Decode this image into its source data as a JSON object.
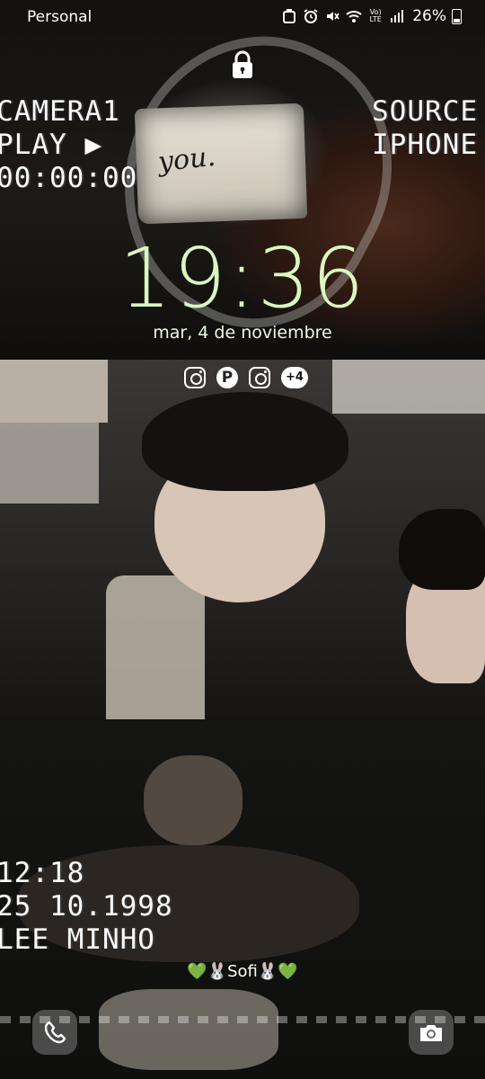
{
  "status_bar": {
    "carrier": "Personal",
    "battery_percent": "26%",
    "icons": [
      "card-icon",
      "alarm-icon",
      "mute-icon",
      "wifi-icon",
      "volte-icon",
      "signal-icon",
      "battery-icon"
    ],
    "volte_label": "Vo)\nLTE"
  },
  "lock": {
    "icon": "lock-icon"
  },
  "wallpaper": {
    "note_text": "you.",
    "vcr_top_left": "CAMERA1\nPLAY ▶\n00:00:00",
    "vcr_top_right": "SOURCE\nIPHONE",
    "vcr_bottom": "12:18\n25 10.1998\nLEE MINHO"
  },
  "clock": {
    "time": "19:36",
    "date": "mar, 4 de noviembre",
    "color": "#d9f7c0"
  },
  "notifications": {
    "icons": [
      "instagram-icon",
      "pinterest-icon",
      "instagram-icon"
    ],
    "more_count": "+4"
  },
  "owner_info": "💚🐰Sofi🐰💚",
  "shortcuts": {
    "left": "phone-icon",
    "right": "camera-icon"
  }
}
